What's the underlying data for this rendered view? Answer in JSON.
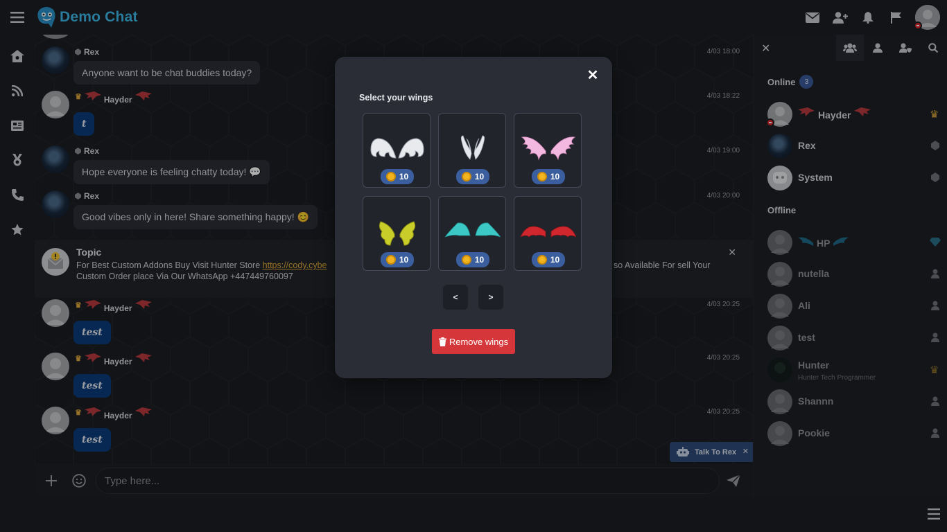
{
  "app": {
    "title": "Demo Chat"
  },
  "messages": [
    {
      "user": "Rex",
      "time": "4/03 18:00",
      "text": "Anyone want to be chat buddies today?"
    },
    {
      "user": "Hayder",
      "time": "4/03 18:22",
      "text": "t"
    },
    {
      "user": "Rex",
      "time": "4/03 19:00",
      "text": "Hope everyone is feeling chatty today! 💬"
    },
    {
      "user": "Rex",
      "time": "4/03 20:00",
      "text": "Good vibes only in here! Share something happy! 😊"
    },
    {
      "user": "Hayder",
      "time": "4/03 20:25",
      "text": "test"
    },
    {
      "user": "Hayder",
      "time": "4/03 20:25",
      "text": "test"
    },
    {
      "user": "Hayder",
      "time": "4/03 20:25",
      "text": "test"
    }
  ],
  "topic": {
    "title": "Topic",
    "text_before": "For Best Custom Addons Buy Visit Hunter Store ",
    "link": "https://cody.cybe",
    "text_middle": "so Available For sell Your",
    "text_line2": "Custom Order place Via Our WhatsApp +447449760097"
  },
  "input": {
    "placeholder": "Type here..."
  },
  "rex_bot": {
    "label": "Talk To Rex"
  },
  "userlist": {
    "online_label": "Online",
    "online_count": "3",
    "offline_label": "Offline",
    "online": [
      {
        "name": "Hayder",
        "rank": "crown"
      },
      {
        "name": "Rex",
        "rank": "bot"
      },
      {
        "name": "System",
        "rank": "bot"
      }
    ],
    "offline": [
      {
        "name": "HP",
        "rank": "diamond"
      },
      {
        "name": "nutella",
        "rank": "user"
      },
      {
        "name": "Ali",
        "rank": "user"
      },
      {
        "name": "test",
        "rank": "user"
      },
      {
        "name": "Hunter",
        "subtitle": "Hunter Tech Programmer",
        "rank": "crown"
      },
      {
        "name": "Shannn",
        "rank": "user"
      },
      {
        "name": "Pookie",
        "rank": "user"
      }
    ]
  },
  "modal": {
    "title": "Select your wings",
    "wings": [
      {
        "icon": "white-wings-icon",
        "price": "10"
      },
      {
        "icon": "angel-wings-icon",
        "price": "10"
      },
      {
        "icon": "pink-wings-icon",
        "price": "10"
      },
      {
        "icon": "yellow-wings-icon",
        "price": "10"
      },
      {
        "icon": "teal-wings-icon",
        "price": "10"
      },
      {
        "icon": "red-wings-icon",
        "price": "10"
      }
    ],
    "prev_label": "<",
    "next_label": ">",
    "remove_label": "Remove wings"
  },
  "colors": {
    "accent": "#3fb7e8",
    "bubble_blue": "#0b3c7a",
    "remove_red": "#d5363a",
    "badge_blue": "#3a5e9e"
  }
}
